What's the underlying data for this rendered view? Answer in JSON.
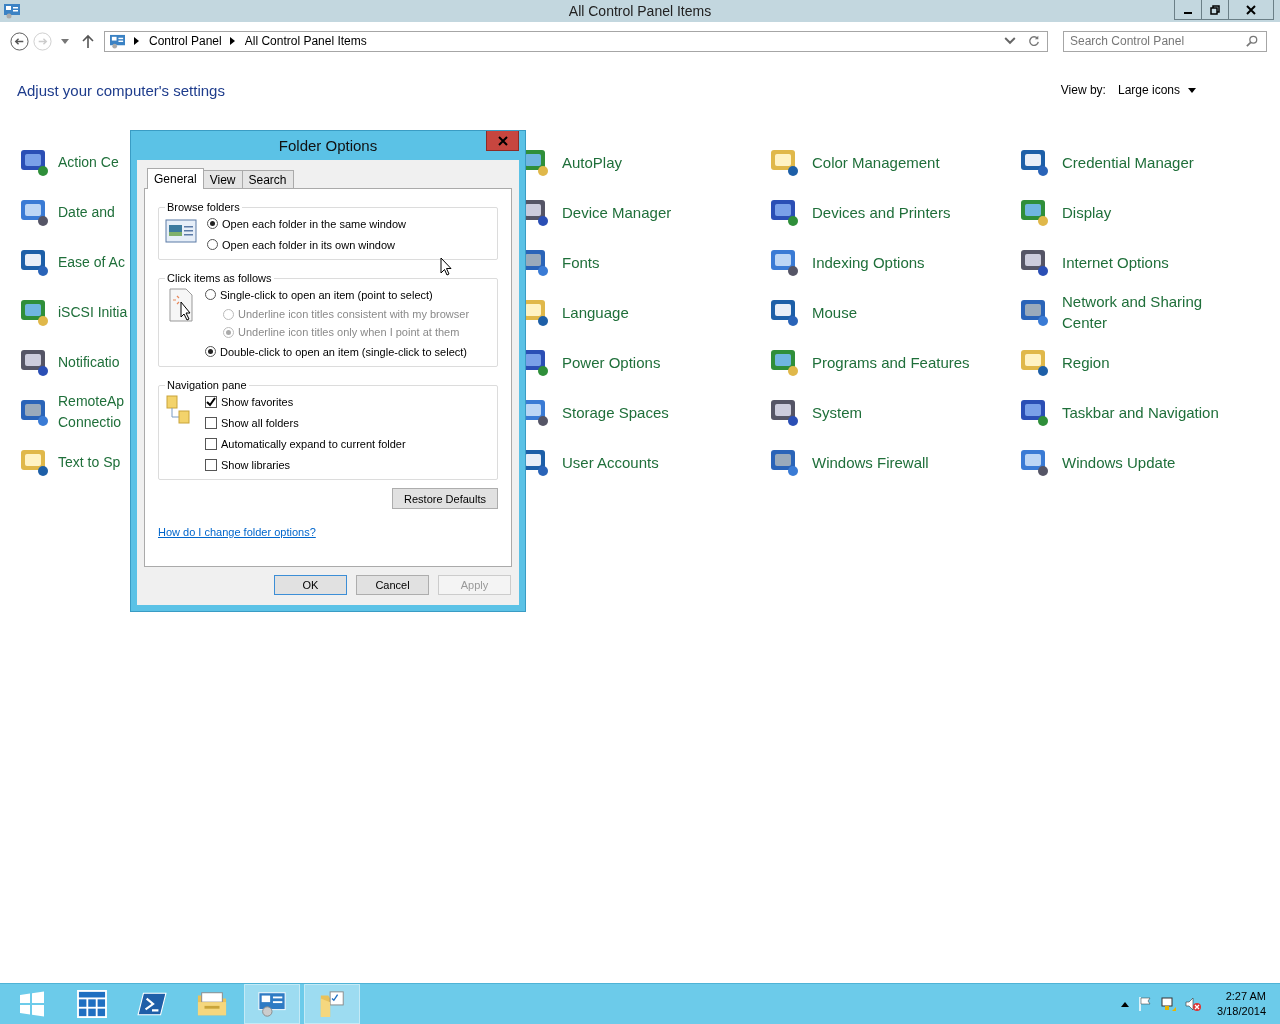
{
  "window": {
    "title": "All Control Panel Items"
  },
  "address": {
    "crumbs": [
      "Control Panel",
      "All Control Panel Items"
    ]
  },
  "search": {
    "placeholder": "Search Control Panel"
  },
  "heading": "Adjust your computer's settings",
  "view_by": {
    "label": "View by:",
    "value": "Large icons"
  },
  "columns": [
    {
      "items": [
        {
          "label": "Action Ce"
        },
        {
          "label": "Date and"
        },
        {
          "label": "Ease of Ac"
        },
        {
          "label": "iSCSI Initia"
        },
        {
          "label": "Notificatio"
        },
        {
          "label": "RemoteAp Connectio"
        },
        {
          "label": "Text to Sp"
        }
      ]
    },
    {
      "items": [
        {
          "label": "AutoPlay"
        },
        {
          "label": "Device Manager"
        },
        {
          "label": "Fonts"
        },
        {
          "label": "Language"
        },
        {
          "label": "Power Options"
        },
        {
          "label": "Storage Spaces"
        },
        {
          "label": "User Accounts"
        }
      ]
    },
    {
      "items": [
        {
          "label": "Color Management"
        },
        {
          "label": "Devices and Printers"
        },
        {
          "label": "Indexing Options"
        },
        {
          "label": "Mouse"
        },
        {
          "label": "Programs and Features"
        },
        {
          "label": "System"
        },
        {
          "label": "Windows Firewall"
        }
      ]
    },
    {
      "items": [
        {
          "label": "Credential Manager"
        },
        {
          "label": "Display"
        },
        {
          "label": "Internet Options"
        },
        {
          "label": "Network and Sharing Center"
        },
        {
          "label": "Region"
        },
        {
          "label": "Taskbar and Navigation"
        },
        {
          "label": "Windows Update"
        }
      ]
    }
  ],
  "dialog": {
    "title": "Folder Options",
    "tabs": [
      {
        "label": "General",
        "selected": true
      },
      {
        "label": "View",
        "selected": false
      },
      {
        "label": "Search",
        "selected": false
      }
    ],
    "browse_folders": {
      "title": "Browse folders",
      "options": [
        {
          "label": "Open each folder in the same window",
          "selected": true
        },
        {
          "label": "Open each folder in its own window",
          "selected": false
        }
      ]
    },
    "click_items": {
      "title": "Click items as follows",
      "options": [
        {
          "label": "Single-click to open an item (point to select)",
          "selected": false,
          "children": [
            {
              "label": "Underline icon titles consistent with my browser",
              "selected": false,
              "disabled": true
            },
            {
              "label": "Underline icon titles only when I point at them",
              "selected": true,
              "disabled": true
            }
          ]
        },
        {
          "label": "Double-click to open an item (single-click to select)",
          "selected": true
        }
      ]
    },
    "navigation_pane": {
      "title": "Navigation pane",
      "options": [
        {
          "label": "Show favorites",
          "checked": true
        },
        {
          "label": "Show all folders",
          "checked": false
        },
        {
          "label": "Automatically expand to current folder",
          "checked": false
        },
        {
          "label": "Show libraries",
          "checked": false
        }
      ]
    },
    "restore_button": "Restore Defaults",
    "help_link": "How do I change folder options?",
    "buttons": [
      {
        "label": "OK",
        "disabled": false
      },
      {
        "label": "Cancel",
        "disabled": false
      },
      {
        "label": "Apply",
        "disabled": true
      }
    ]
  },
  "taskbar": {
    "buttons": [
      {
        "kind": "start",
        "active": false
      },
      {
        "kind": "tiles",
        "active": false
      },
      {
        "kind": "shell",
        "active": false
      },
      {
        "kind": "explorer",
        "active": false
      },
      {
        "kind": "control",
        "active": true
      },
      {
        "kind": "folder",
        "active": true
      }
    ],
    "time": "2:27 AM",
    "date": "3/18/2014"
  }
}
